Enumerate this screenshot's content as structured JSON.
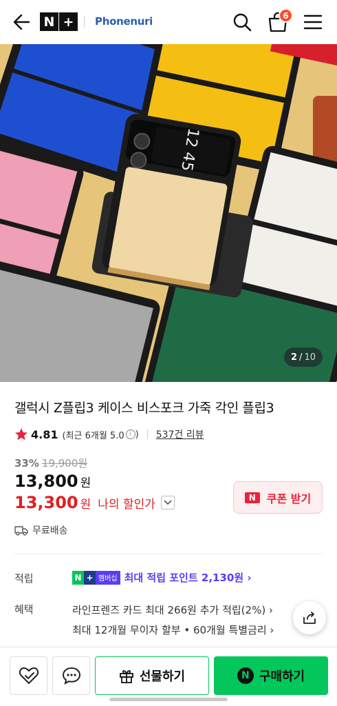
{
  "header": {
    "nplus_n": "N",
    "nplus_plus": "+",
    "brand": "Phonenuri",
    "cart_count": "6"
  },
  "hero": {
    "pager_current": "2",
    "pager_sep": "/",
    "pager_total": "10",
    "phone_screen_time": "12 45"
  },
  "product": {
    "title": "갤럭시 Z플립3 케이스 비스포크 가죽 각인 플립3",
    "rating": "4.81",
    "recent_rating": "(최근 6개월 5.0",
    "info_mark": "i",
    "recent_close": ")",
    "reviews": "537건 리뷰",
    "discount_pct": "33%",
    "original_price": "19,900원",
    "price": "13,800",
    "price_unit": "원",
    "my_price": "13,300",
    "my_price_unit": "원",
    "my_price_label": "나의 할인가",
    "shipping": "무료배송"
  },
  "coupon": {
    "logo": "N",
    "label": "쿠폰 받기"
  },
  "points": {
    "label": "적립",
    "badge_n": "N",
    "badge_plus": "+",
    "badge_member": "멤버십",
    "text": "최대 적립 포인트 2,130원 ›"
  },
  "benefits": {
    "label": "혜택",
    "line1": "라인프렌즈 카드 최대 266원 추가 적립(2%) ›",
    "line2": "최대 12개월 무이자 할부 • 60개월 특별금리 ›"
  },
  "bottom": {
    "gift_label": "선물하기",
    "buy_logo": "N",
    "buy_label": "구매하기"
  },
  "colors": {
    "naver_green": "#03c75a",
    "price_red": "#e02020",
    "coupon_red": "#e8243a",
    "points_purple": "#5b3df5",
    "star": "#e8243a"
  }
}
